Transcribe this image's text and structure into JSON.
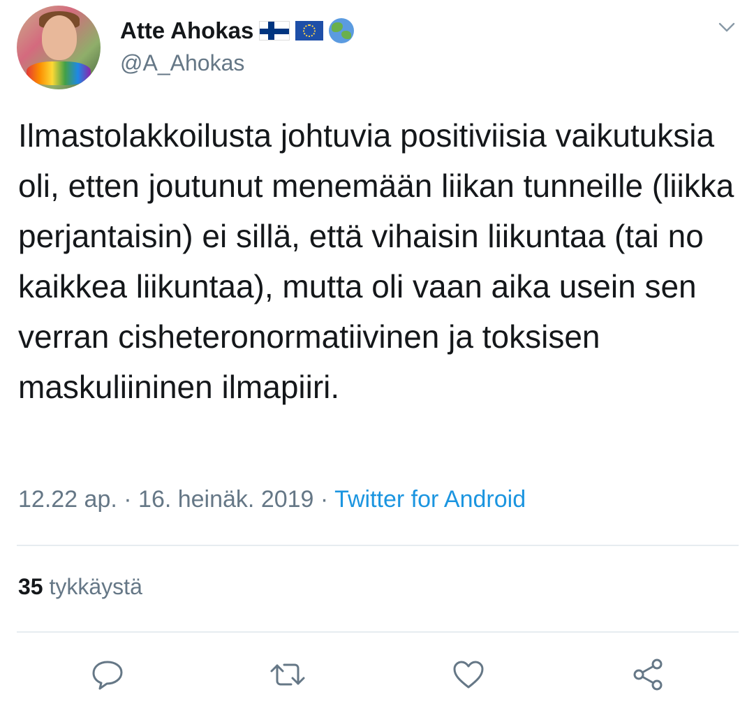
{
  "user": {
    "display_name": "Atte Ahokas",
    "emoji": [
      "finland-flag",
      "eu-flag",
      "globe-earth"
    ],
    "handle": "@A_Ahokas"
  },
  "tweet": {
    "text": "Ilmastolakkoilusta johtuvia positiviisia vaikutuksia oli, etten joutunut menemään liikan tunneille (liikka perjantaisin) ei sillä, että vihaisin liikuntaa (tai no kaikkea liikuntaa), mutta oli vaan aika usein sen verran cisheteronormatiivinen ja toksisen maskuliininen ilmapiiri.",
    "time": "12.22 ap.",
    "separator": "·",
    "date": "16. heinäk. 2019",
    "source": "Twitter for Android"
  },
  "stats": {
    "likes_count": "35",
    "likes_label": "tykkäystä"
  },
  "colors": {
    "text": "#14171a",
    "secondary": "#657786",
    "link": "#1b95e0",
    "divider": "#e6ecf0"
  },
  "actions": [
    "reply-icon",
    "retweet-icon",
    "like-icon",
    "share-icon"
  ]
}
